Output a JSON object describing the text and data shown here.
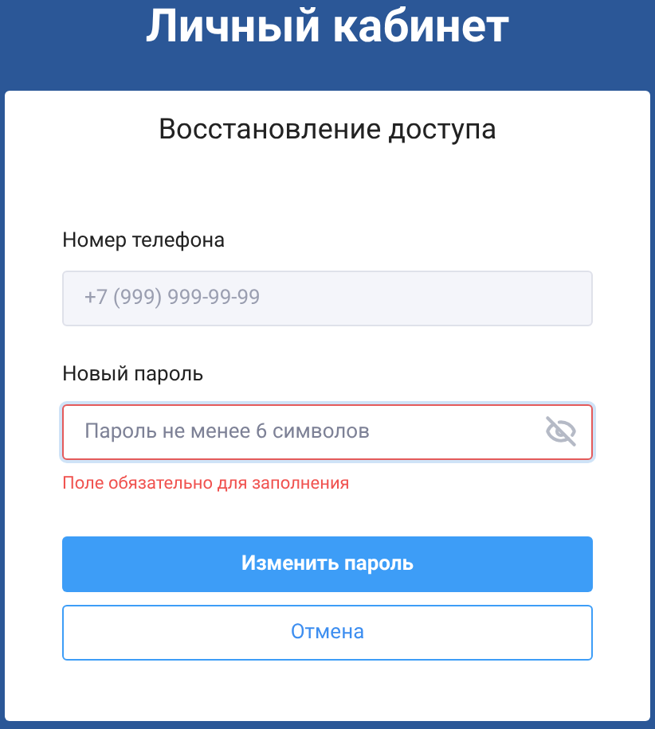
{
  "header": {
    "title": "Личный кабинет"
  },
  "card": {
    "title": "Восстановление доступа"
  },
  "fields": [
    {
      "kind": "phone",
      "label": "Номер телефона",
      "placeholder": "+7 (999) 999-99-99",
      "disabled": true,
      "invalid": false
    },
    {
      "kind": "password",
      "label": "Новый пароль",
      "placeholder": "Пароль не менее 6 символов",
      "disabled": false,
      "invalid": true,
      "error": "Поле обязательно для заполнения"
    }
  ],
  "buttons": [
    {
      "kind": "primary",
      "label": "Изменить пароль"
    },
    {
      "kind": "outline",
      "label": "Отмена"
    }
  ]
}
